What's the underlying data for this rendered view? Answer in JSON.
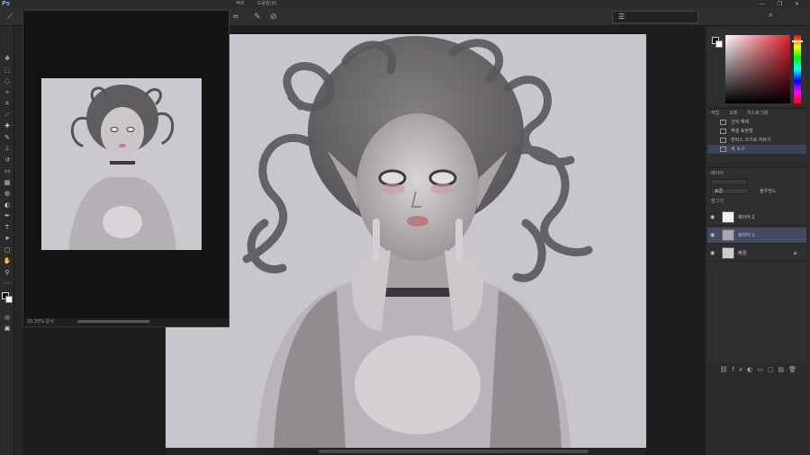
{
  "app": {
    "logo": "Ps",
    "window_buttons": "— ❐ ✕"
  },
  "menubar": {
    "doc_path": "",
    "menu_a": "액체",
    "menu_b": "도움말(H)"
  },
  "navigator": {
    "status": "33.33% 문서"
  },
  "history": {
    "tabs": [
      "작업",
      "보정",
      "히스토그램"
    ],
    "items": [
      {
        "label": "선택 해제"
      },
      {
        "label": "픽셀 표현형"
      },
      {
        "label": "캔버스 크기로 자르기"
      },
      {
        "label": "새 도구"
      }
    ]
  },
  "layers": {
    "tab": "레이어",
    "mode": "표준",
    "opacity_label": "불투명도",
    "lock_label": "잠그기",
    "items": [
      {
        "name": "레이어 2"
      },
      {
        "name": "레이어 1"
      },
      {
        "name": "배경"
      }
    ]
  },
  "colors": {
    "accent": "#e41e2b",
    "active_row": "#424b63"
  },
  "icons": [
    "search-icon",
    "brush-icon",
    "eye-icon",
    "lock-icon"
  ]
}
